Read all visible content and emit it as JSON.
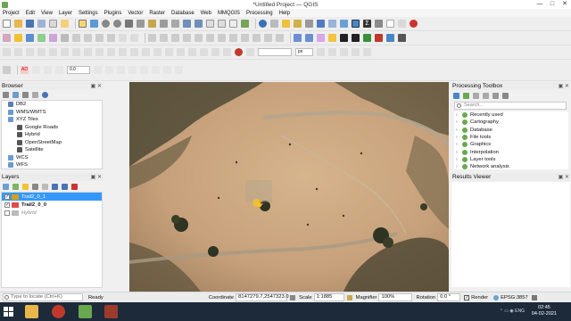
{
  "window": {
    "title": "*Untitled Project — QGIS",
    "min": "—",
    "max": "□",
    "close": "✕"
  },
  "menu": [
    "Project",
    "Edit",
    "View",
    "Layer",
    "Settings",
    "Plugins",
    "Vector",
    "Raster",
    "Database",
    "Web",
    "MMQGIS",
    "Processing",
    "Help"
  ],
  "toolbar3": {
    "field_a": "0.0",
    "field_b": "",
    "unit": "px"
  },
  "browser": {
    "title": "Browser",
    "items": [
      {
        "label": "DB2",
        "indent": 1,
        "color": "#5b7fb5"
      },
      {
        "label": "WMS/WMTS",
        "indent": 1,
        "color": "#6b9bd1"
      },
      {
        "label": "XYZ Tiles",
        "indent": 1,
        "color": "#6b9bd1"
      },
      {
        "label": "Google Roads",
        "indent": 3,
        "color": "#555555"
      },
      {
        "label": "Hybrid",
        "indent": 3,
        "color": "#555555"
      },
      {
        "label": "OpenStreetMap",
        "indent": 3,
        "color": "#555555"
      },
      {
        "label": "Satellite",
        "indent": 3,
        "color": "#555555"
      },
      {
        "label": "WCS",
        "indent": 1,
        "color": "#6b9bd1"
      },
      {
        "label": "WFS",
        "indent": 1,
        "color": "#6b9bd1"
      }
    ]
  },
  "layers": {
    "title": "Layers",
    "items": [
      {
        "label": "Trail2_0_1",
        "checked": true,
        "selected": true,
        "swatch": "#d6a11c"
      },
      {
        "label": "Trail2_0_0",
        "checked": true,
        "selected": false,
        "swatch": "#e04c4c"
      },
      {
        "label": "Hybrid",
        "checked": false,
        "selected": false,
        "swatch": "#bbbbbb"
      }
    ]
  },
  "processing": {
    "title": "Processing Toolbox",
    "search_placeholder": "Search...",
    "items": [
      "Recently used",
      "Cartography",
      "Database",
      "File tools",
      "Graphics",
      "Interpolation",
      "Layer tools",
      "Network analysis"
    ]
  },
  "results": {
    "title": "Results Viewer"
  },
  "status": {
    "locate_placeholder": "Type to locate (Ctrl+K)",
    "ready": "Ready",
    "coordinate_label": "Coordinate",
    "coordinate": "8147279.7,2547323.0",
    "scale_label": "Scale",
    "scale": "1:1885",
    "magnifier_label": "Magnifier",
    "magnifier": "100%",
    "rotation_label": "Rotation",
    "rotation": "0.0 °",
    "render_label": "Render",
    "crs": "EPSG:3857"
  },
  "taskbar": {
    "time": "02:45",
    "date": "04-02-2021",
    "lang": "ENG"
  },
  "colors": {
    "selection": "#3399ff",
    "taskbar": "#1c2a3a",
    "qgis_green": "#6aa84f"
  }
}
